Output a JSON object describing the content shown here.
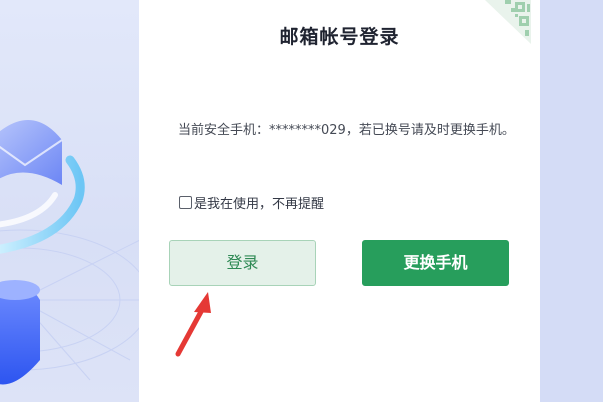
{
  "dialog": {
    "title": "邮箱帐号登录",
    "notice": "当前安全手机：********029，若已换号请及时更换手机。",
    "checkbox_label": "是我在使用，不再提醒",
    "login_button": "登录",
    "change_phone_button": "更换手机"
  },
  "colors": {
    "primary_green": "#279e5c",
    "light_green_bg": "#e4f1e9",
    "arrow_red": "#e53935",
    "background": "#dfe5f7"
  },
  "icons": {
    "corner": "qr-code-icon",
    "annotation": "red-arrow-icon"
  }
}
